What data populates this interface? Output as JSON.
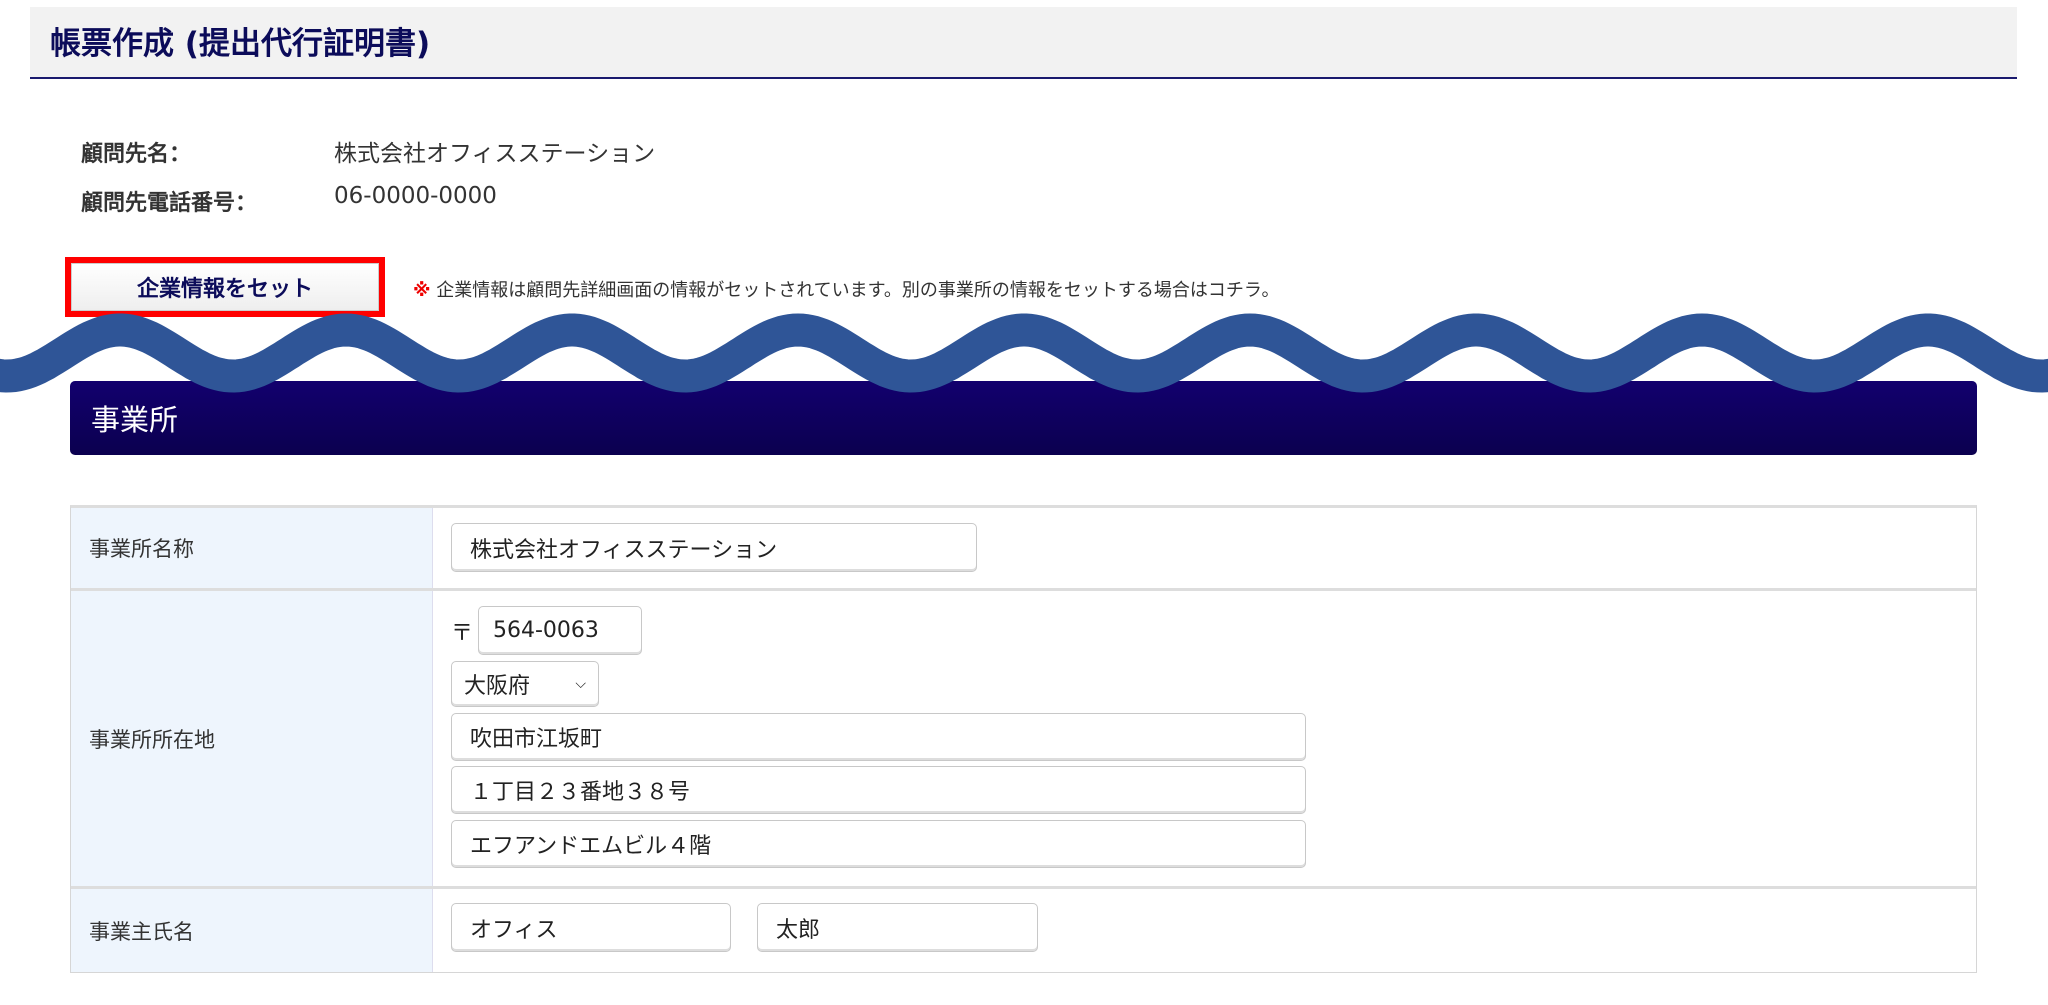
{
  "header": {
    "title": "帳票作成 (提出代行証明書)"
  },
  "client": {
    "name_label": "顧問先名：",
    "name_value": "株式会社オフィスステーション",
    "phone_label": "顧問先電話番号：",
    "phone_value": "06-0000-0000"
  },
  "set_button": {
    "label": "企業情報をセット"
  },
  "note": {
    "mark": "※",
    "text": " 企業情報は顧問先詳細画面の情報がセットされています。別の事業所の情報をセットする場合はコチラ。"
  },
  "section": {
    "title": "事業所"
  },
  "form": {
    "office_name": {
      "label": "事業所名称",
      "value": "株式会社オフィスステーション"
    },
    "address": {
      "label": "事業所所在地",
      "postal_mark": "〒",
      "postal": "564-0063",
      "prefecture": "大阪府",
      "line1": "吹田市江坂町",
      "line2": "１丁目２３番地３８号",
      "line3": "エフアンドエムビル４階"
    },
    "owner": {
      "label": "事業主氏名",
      "last_name": "オフィス",
      "first_name": "太郎"
    }
  },
  "colors": {
    "accent": "#0c0c5a",
    "highlight": "#ff0000",
    "wave": "#2f5597",
    "section_bg": "#10006a"
  }
}
